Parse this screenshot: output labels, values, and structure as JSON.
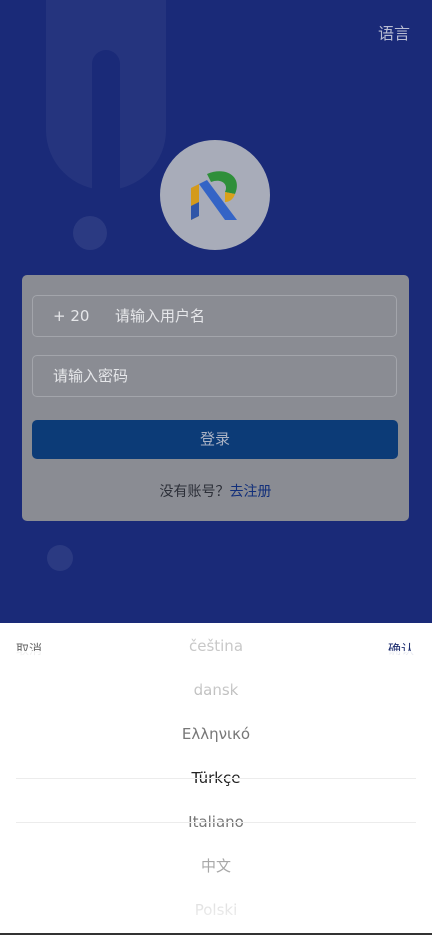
{
  "header": {
    "language_label": "语言"
  },
  "login": {
    "country_code": "+ 20",
    "username_placeholder": "请输入用户名",
    "password_placeholder": "请输入密码",
    "login_label": "登录",
    "no_account_text": "没有账号？",
    "register_link": "去注册"
  },
  "picker": {
    "cancel_label": "取消",
    "confirm_label": "确认",
    "items": [
      "čeština",
      "dansk",
      "Ελληνικό",
      "Türkçe",
      "Italiano",
      "中文",
      "Polski"
    ],
    "selected": "Türkçe"
  },
  "colors": {
    "background": "#1a2a78",
    "card": "#8a8c93",
    "button": "#0c3b77",
    "link": "#122f7a"
  }
}
